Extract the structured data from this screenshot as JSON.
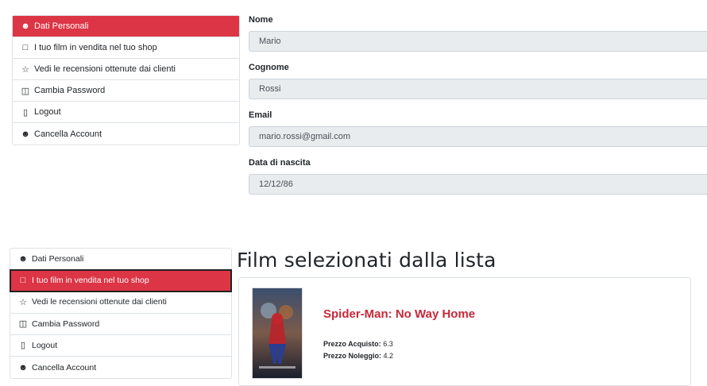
{
  "profile_menu": {
    "items": [
      {
        "label": "Dati Personali",
        "icon": "user-icon"
      },
      {
        "label": "I tuo film in vendita nel tuo shop",
        "icon": "shopping-bag-icon"
      },
      {
        "label": "Vedi le recensioni ottenute dai clienti",
        "icon": "star-icon"
      },
      {
        "label": "Cambia Password",
        "icon": "lock-icon"
      },
      {
        "label": "Logout",
        "icon": "door-icon"
      },
      {
        "label": "Cancella Account",
        "icon": "user-remove-icon"
      }
    ]
  },
  "personal_data": {
    "first_name": {
      "label": "Nome",
      "value": "Mario"
    },
    "last_name": {
      "label": "Cognome",
      "value": "Rossi"
    },
    "email": {
      "label": "Email",
      "value": "mario.rossi@gmail.com"
    },
    "birth_date": {
      "label": "Data di nascita",
      "value": "12/12/86"
    }
  },
  "shop": {
    "title": "Film selezionati dalla lista",
    "movie": {
      "title": "Spider-Man: No Way Home",
      "purchase_label": "Prezzo Acquisto:",
      "purchase_price": "6.3",
      "rental_label": "Prezzo Noleggio:",
      "rental_price": "4.2"
    }
  },
  "colors": {
    "accent": "#dc3545",
    "movie_title": "#c8283a",
    "input_bg": "#e9ecef"
  }
}
